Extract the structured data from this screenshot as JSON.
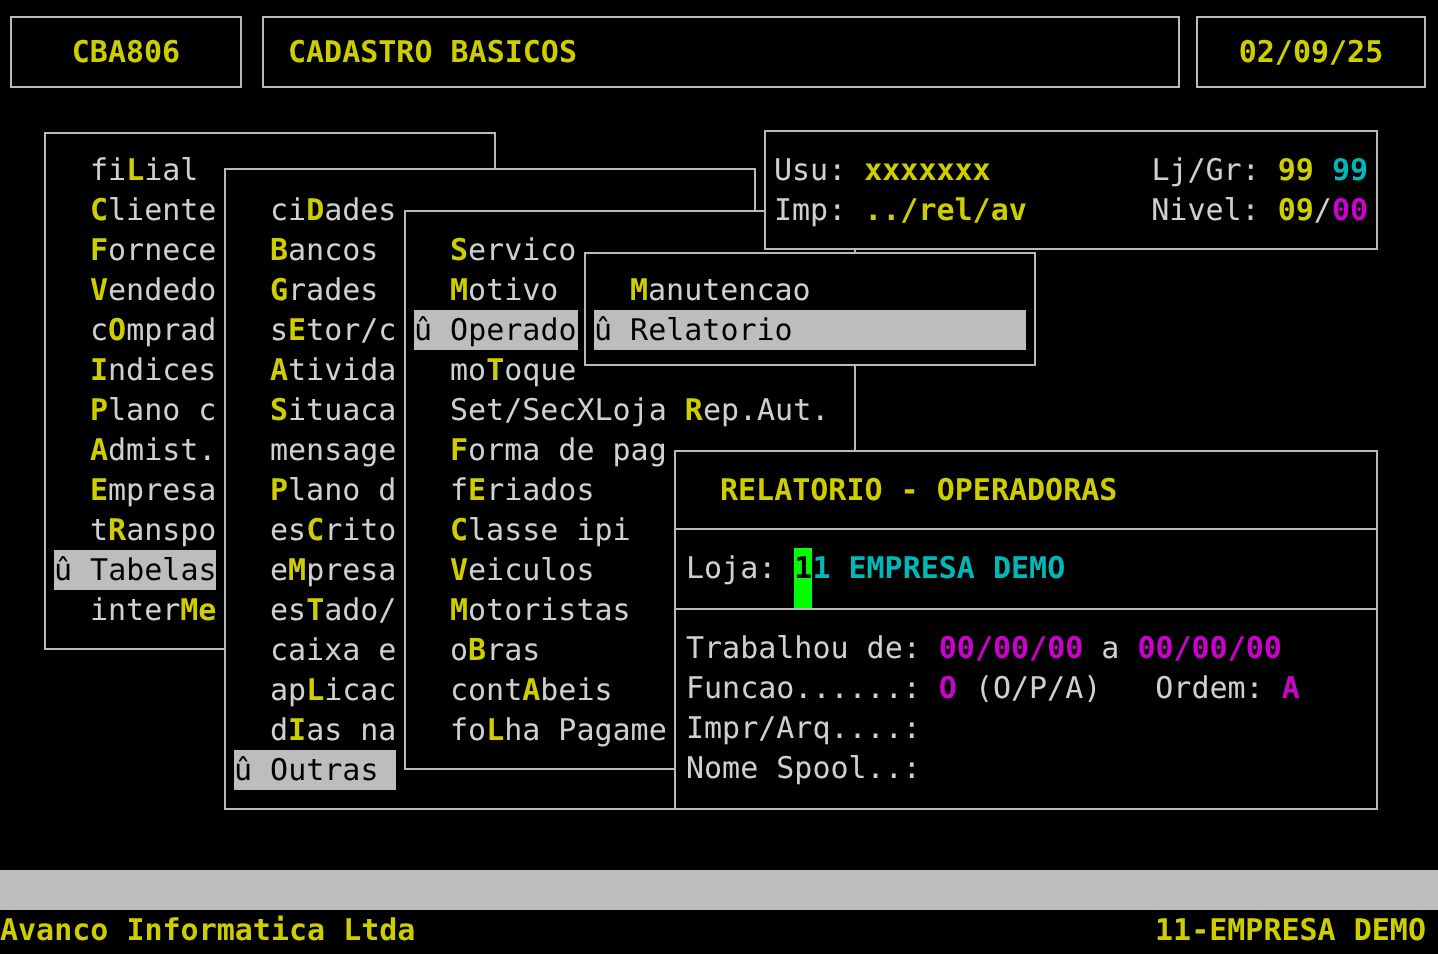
{
  "header": {
    "program": "CBA806",
    "title": "CADASTRO BASICOS",
    "date": "02/09/25"
  },
  "session": {
    "user_label": "Usu:",
    "user": "xxxxxxx",
    "printer_label": "Imp:",
    "printer": "../rel/av",
    "store_group_label": "Lj/Gr:",
    "store": "99",
    "group": "99",
    "level_label": "Nivel:",
    "level_main": "09",
    "level_sep": "/",
    "level_sub": "00"
  },
  "menus": [
    {
      "items": [
        {
          "pre": "fi",
          "key": "L",
          "post": "ial",
          "selected": false
        },
        {
          "key": "C",
          "post": "liente",
          "selected": false
        },
        {
          "key": "F",
          "post": "ornece",
          "selected": false
        },
        {
          "key": "V",
          "post": "endedo",
          "selected": false
        },
        {
          "pre": "c",
          "key": "O",
          "post": "mprad",
          "selected": false
        },
        {
          "key": "I",
          "post": "ndices",
          "selected": false
        },
        {
          "key": "P",
          "post": "lano c",
          "selected": false
        },
        {
          "key": "A",
          "post": "dmist.",
          "selected": false
        },
        {
          "key": "E",
          "post": "mpresa",
          "selected": false
        },
        {
          "pre": "t",
          "key": "R",
          "post": "anspo",
          "selected": false
        },
        {
          "label": "û Tabelas",
          "selected": true
        },
        {
          "pre": "inter",
          "key": "Me",
          "selected": false
        }
      ]
    },
    {
      "items": [
        {
          "pre": "ci",
          "key": "D",
          "post": "ades",
          "selected": false
        },
        {
          "key": "B",
          "post": "ancos",
          "selected": false
        },
        {
          "key": "G",
          "post": "rades",
          "selected": false
        },
        {
          "pre": "s",
          "key": "E",
          "post": "tor/c",
          "selected": false
        },
        {
          "key": "A",
          "post": "tivida",
          "selected": false
        },
        {
          "key": "S",
          "post": "ituaca",
          "selected": false
        },
        {
          "pre": "mensage",
          "selected": false
        },
        {
          "key": "P",
          "post": "lano d",
          "selected": false
        },
        {
          "pre": "es",
          "key": "C",
          "post": "rito",
          "selected": false
        },
        {
          "pre": "e",
          "key": "M",
          "post": "presa",
          "selected": false
        },
        {
          "pre": "es",
          "key": "T",
          "post": "ado/",
          "selected": false
        },
        {
          "pre": "caixa e",
          "selected": false
        },
        {
          "pre": "ap",
          "key": "L",
          "post": "icac",
          "selected": false
        },
        {
          "pre": "d",
          "key": "I",
          "post": "as na",
          "selected": false
        },
        {
          "label": "û Outras",
          "selected": true
        }
      ]
    },
    {
      "items": [
        {
          "key": "S",
          "post": "ervico",
          "selected": false
        },
        {
          "key": "M",
          "post": "otivo",
          "selected": false
        },
        {
          "label": "û Operado",
          "selected": true
        },
        {
          "pre": "mo",
          "key": "T",
          "post": "oque",
          "selected": false
        },
        {
          "pre": "Set/SecXLoja ",
          "key": "R",
          "post": "ep.Aut.",
          "selected": false
        },
        {
          "key": "F",
          "post": "orma de pag",
          "selected": false
        },
        {
          "pre": "f",
          "key": "E",
          "post": "riados",
          "selected": false
        },
        {
          "key": "C",
          "post": "lasse ipi",
          "selected": false
        },
        {
          "key": "V",
          "post": "eiculos",
          "selected": false
        },
        {
          "key": "M",
          "post": "otoristas",
          "selected": false
        },
        {
          "pre": "o",
          "key": "B",
          "post": "ras",
          "selected": false
        },
        {
          "pre": "cont",
          "key": "A",
          "post": "beis",
          "selected": false
        },
        {
          "pre": "fo",
          "key": "L",
          "post": "ha Pagame",
          "selected": false
        }
      ]
    },
    {
      "items": [
        {
          "key": "M",
          "post": "anutencao",
          "selected": false
        },
        {
          "label": "û Relatorio",
          "selected": true
        }
      ]
    }
  ],
  "report": {
    "title": "RELATORIO - OPERADORAS",
    "store_label": "Loja:",
    "store_cursor": "1",
    "store_value": "1 EMPRESA DEMO",
    "fields": [
      {
        "kind": "date_range",
        "label": "Trabalhou de:",
        "from": "00/00/00",
        "sep": "a",
        "to": "00/00/00"
      },
      {
        "kind": "choice",
        "label": "Funcao......:",
        "value": "O",
        "hint": "(O/P/A)",
        "label2": "Ordem:",
        "value2": "A"
      },
      {
        "kind": "text",
        "label": "Impr/Arq....:"
      },
      {
        "kind": "text",
        "label": "Nome Spool..:"
      }
    ]
  },
  "footer": {
    "company": "Avanco Informatica Ltda",
    "store": "11-EMPRESA DEMO"
  }
}
